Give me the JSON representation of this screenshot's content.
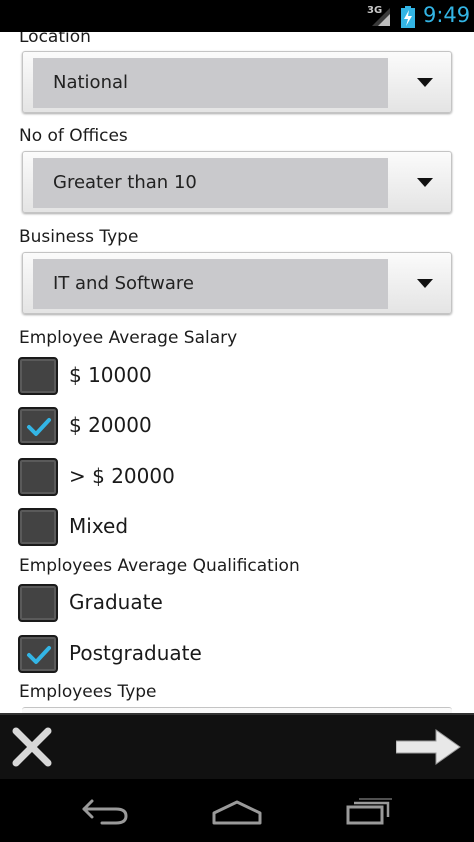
{
  "status_bar": {
    "network": "3G",
    "time": "9:49"
  },
  "form": {
    "location": {
      "label": "Location",
      "value": "National"
    },
    "offices": {
      "label": "No of Offices",
      "value": "Greater than 10"
    },
    "business": {
      "label": "Business Type",
      "value": "IT and Software"
    },
    "salary": {
      "label": "Employee Average Salary",
      "options": [
        {
          "label": "$ 10000",
          "checked": false
        },
        {
          "label": "$ 20000",
          "checked": true
        },
        {
          "label": "> $ 20000",
          "checked": false
        },
        {
          "label": "Mixed",
          "checked": false
        }
      ]
    },
    "qualification": {
      "label": "Employees Average Qualification",
      "options": [
        {
          "label": "Graduate",
          "checked": false
        },
        {
          "label": "Postgraduate",
          "checked": true
        }
      ]
    },
    "employees_type": {
      "label": "Employees Type"
    }
  },
  "action_bar": {
    "close_icon": "close-icon",
    "next_icon": "arrow-right-icon"
  },
  "nav_bar": {
    "back_icon": "back-icon",
    "home_icon": "home-icon",
    "recent_icon": "recent-apps-icon"
  },
  "colors": {
    "accent": "#33b5e5",
    "checkbox_bg": "#434343",
    "spinner_value_bg": "#c9c9cc"
  }
}
